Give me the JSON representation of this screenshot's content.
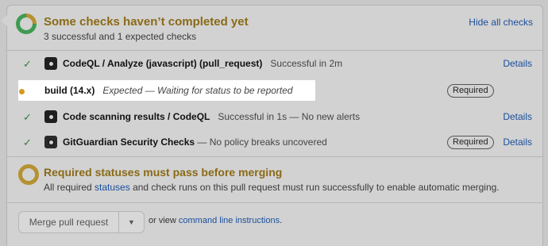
{
  "header": {
    "title": "Some checks haven’t completed yet",
    "subtitle": "3 successful and 1 expected checks",
    "hide_all_label": "Hide all checks"
  },
  "checks": [
    {
      "status_icon": "check-icon",
      "app_icon": "github-icon",
      "name": "CodeQL / Analyze (javascript) (pull_request)",
      "status": "Successful in 2m",
      "details_label": "Details"
    },
    {
      "status_icon": "pending-dot-icon",
      "name": "build (14.x)",
      "status": "Expected — Waiting for status to be reported",
      "required_label": "Required"
    },
    {
      "status_icon": "check-icon",
      "app_icon": "github-icon",
      "name": "Code scanning results / CodeQL",
      "status": "Successful in 1s — No new alerts",
      "details_label": "Details"
    },
    {
      "status_icon": "check-icon",
      "app_icon": "gitguardian-icon",
      "name": "GitGuardian Security Checks",
      "status": "— No policy breaks uncovered",
      "required_label": "Required",
      "details_label": "Details"
    }
  ],
  "required_section": {
    "title": "Required statuses must pass before merging",
    "text_before": "All required ",
    "link": "statuses",
    "text_after": " and check runs on this pull request must run successfully to enable automatic merging."
  },
  "merge": {
    "button_label": "Merge pull request",
    "caret": "▼",
    "or_view": "or view ",
    "cli_link": "command line instructions",
    "period": "."
  },
  "colors": {
    "accent_warning": "#8a6a16",
    "success": "#2e7d3a",
    "link": "#1a4f9c",
    "pending": "#d39a1c"
  }
}
